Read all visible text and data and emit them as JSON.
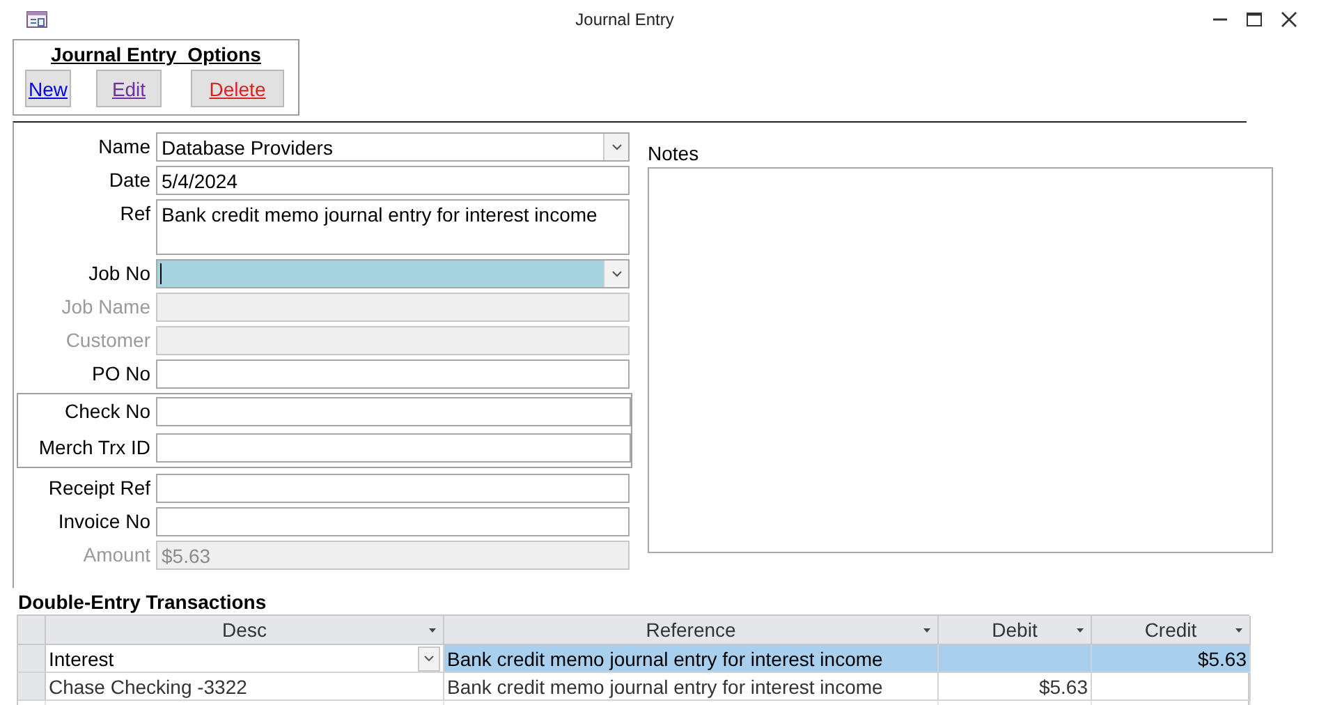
{
  "window": {
    "title": "Journal Entry"
  },
  "options": {
    "title": "Journal Entry  Options",
    "buttons": [
      {
        "label": "New",
        "kind": "new"
      },
      {
        "label": "Edit",
        "kind": "edit"
      },
      {
        "label": "Delete",
        "kind": "delete"
      }
    ]
  },
  "sections": [
    {
      "framed": false,
      "fields": [
        {
          "label": "Name",
          "value": "Database Providers",
          "kind": "combo",
          "disabled": false,
          "focused": false
        },
        {
          "label": "Date",
          "value": "5/4/2024",
          "kind": "text",
          "disabled": false,
          "focused": false
        },
        {
          "label": "Ref",
          "value": "Bank credit memo journal entry for interest income",
          "kind": "memo",
          "disabled": false,
          "focused": false
        },
        {
          "label": "Job No",
          "kind": "combo",
          "disabled": false,
          "focused": true
        },
        {
          "label": "Job Name",
          "kind": "text",
          "disabled": true,
          "focused": false
        },
        {
          "label": "Customer",
          "kind": "text",
          "disabled": true,
          "focused": false
        },
        {
          "label": "PO No",
          "kind": "text",
          "disabled": false,
          "focused": false
        }
      ]
    },
    {
      "framed": true,
      "fields": [
        {
          "label": "Check No",
          "kind": "text",
          "disabled": false,
          "focused": false
        },
        {
          "label": "Merch Trx ID",
          "kind": "text",
          "disabled": false,
          "focused": false
        }
      ]
    },
    {
      "framed": false,
      "fields": [
        {
          "label": "Receipt Ref",
          "kind": "text",
          "disabled": false,
          "focused": false
        },
        {
          "label": "Invoice No",
          "kind": "text",
          "disabled": false,
          "focused": false
        },
        {
          "label": "Amount",
          "value": "$5.63",
          "kind": "text",
          "disabled": true,
          "focused": false
        }
      ]
    }
  ],
  "notes": {
    "label": "Notes"
  },
  "transactions": {
    "title": "Double-Entry Transactions",
    "columns": [
      "Desc",
      "Reference",
      "Debit",
      "Credit"
    ],
    "rows": [
      {
        "selected": true,
        "cells": [
          "Interest",
          "Bank credit memo journal entry for interest income",
          "",
          "$5.63"
        ]
      },
      {
        "selected": false,
        "cells": [
          "Chase Checking -3322",
          "Bank credit memo journal entry for interest income",
          "$5.63",
          ""
        ]
      }
    ]
  }
}
